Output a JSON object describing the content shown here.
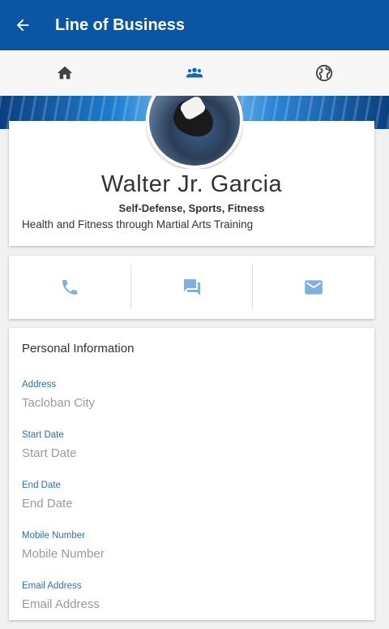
{
  "appbar": {
    "title": "Line of Business",
    "back_icon": "arrow-back-icon"
  },
  "tabs": [
    {
      "icon": "home-icon",
      "color": "#444444"
    },
    {
      "icon": "group-icon",
      "color": "#1565c0"
    },
    {
      "icon": "globe-icon",
      "color": "#444444"
    }
  ],
  "profile": {
    "name": "Walter Jr. Garcia",
    "categories": "Self-Defense, Sports, Fitness",
    "description": "Health and Fitness through Martial Arts Training"
  },
  "contact": [
    {
      "icon": "phone-icon"
    },
    {
      "icon": "chat-icon"
    },
    {
      "icon": "email-icon"
    }
  ],
  "personal_info": {
    "title": "Personal Information",
    "fields": [
      {
        "label": "Address",
        "value": "Tacloban City"
      },
      {
        "label": "Start Date",
        "placeholder": "Start Date"
      },
      {
        "label": "End Date",
        "placeholder": "End Date"
      },
      {
        "label": "Mobile Number",
        "placeholder": "Mobile Number"
      },
      {
        "label": "Email Address",
        "placeholder": "Email Address"
      }
    ]
  },
  "colors": {
    "primary": "#0a56a5",
    "label": "#2d6fb8",
    "icon_light": "#7fb0e0"
  }
}
